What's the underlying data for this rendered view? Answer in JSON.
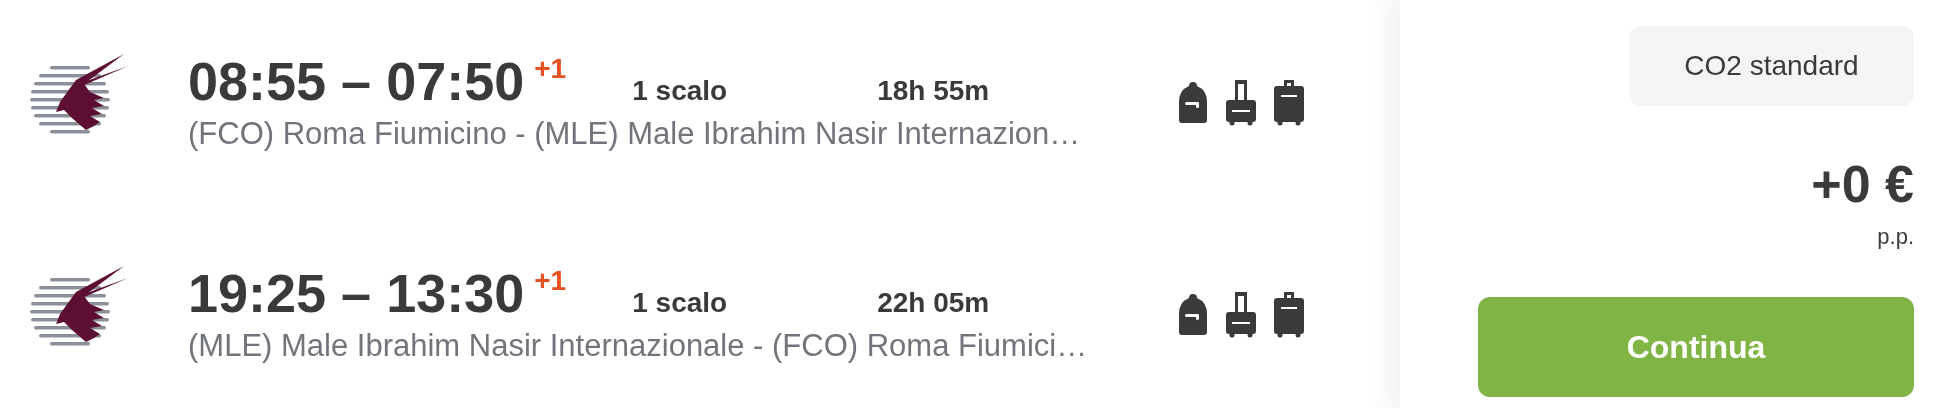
{
  "flights": [
    {
      "times": "08:55 – 07:50",
      "day_offset": "+1",
      "stops": "1 scalo",
      "duration": "18h 55m",
      "route": "(FCO) Roma Fiumicino - (MLE) Male Ibrahim Nasir Internazion…"
    },
    {
      "times": "19:25 – 13:30",
      "day_offset": "+1",
      "stops": "1 scalo",
      "duration": "22h 05m",
      "route": "(MLE) Male Ibrahim Nasir Internazionale - (FCO) Roma Fiumici…"
    }
  ],
  "fare": {
    "label": "CO2 standard",
    "price": "+0 €",
    "price_note": "p.p.",
    "button": "Continua"
  }
}
